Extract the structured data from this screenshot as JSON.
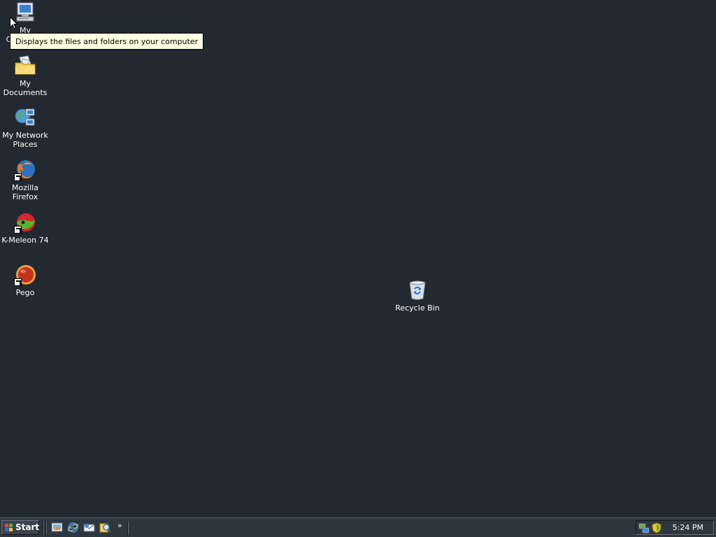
{
  "desktop": {
    "icons": [
      {
        "label": "My Computer",
        "icon": "computer-icon"
      },
      {
        "label": "My Documents",
        "icon": "documents-folder-icon"
      },
      {
        "label": "My Network Places",
        "icon": "network-places-icon"
      },
      {
        "label": "Mozilla Firefox",
        "icon": "firefox-icon"
      },
      {
        "label": "K-Meleon 74",
        "icon": "k-meleon-icon"
      },
      {
        "label": "Pego",
        "icon": "pego-icon"
      },
      {
        "label": "Recycle Bin",
        "icon": "recycle-bin-icon"
      }
    ],
    "tooltip": "Displays the files and folders on your computer"
  },
  "taskbar": {
    "start_label": "Start",
    "quick_launch": [
      {
        "icon": "show-desktop-icon"
      },
      {
        "icon": "internet-explorer-icon"
      },
      {
        "icon": "outlook-express-icon"
      },
      {
        "icon": "search-icon"
      }
    ],
    "more_label": "»",
    "tray": {
      "icons": [
        "network-connection-icon",
        "security-shield-icon"
      ],
      "clock": "5:24 PM"
    }
  }
}
